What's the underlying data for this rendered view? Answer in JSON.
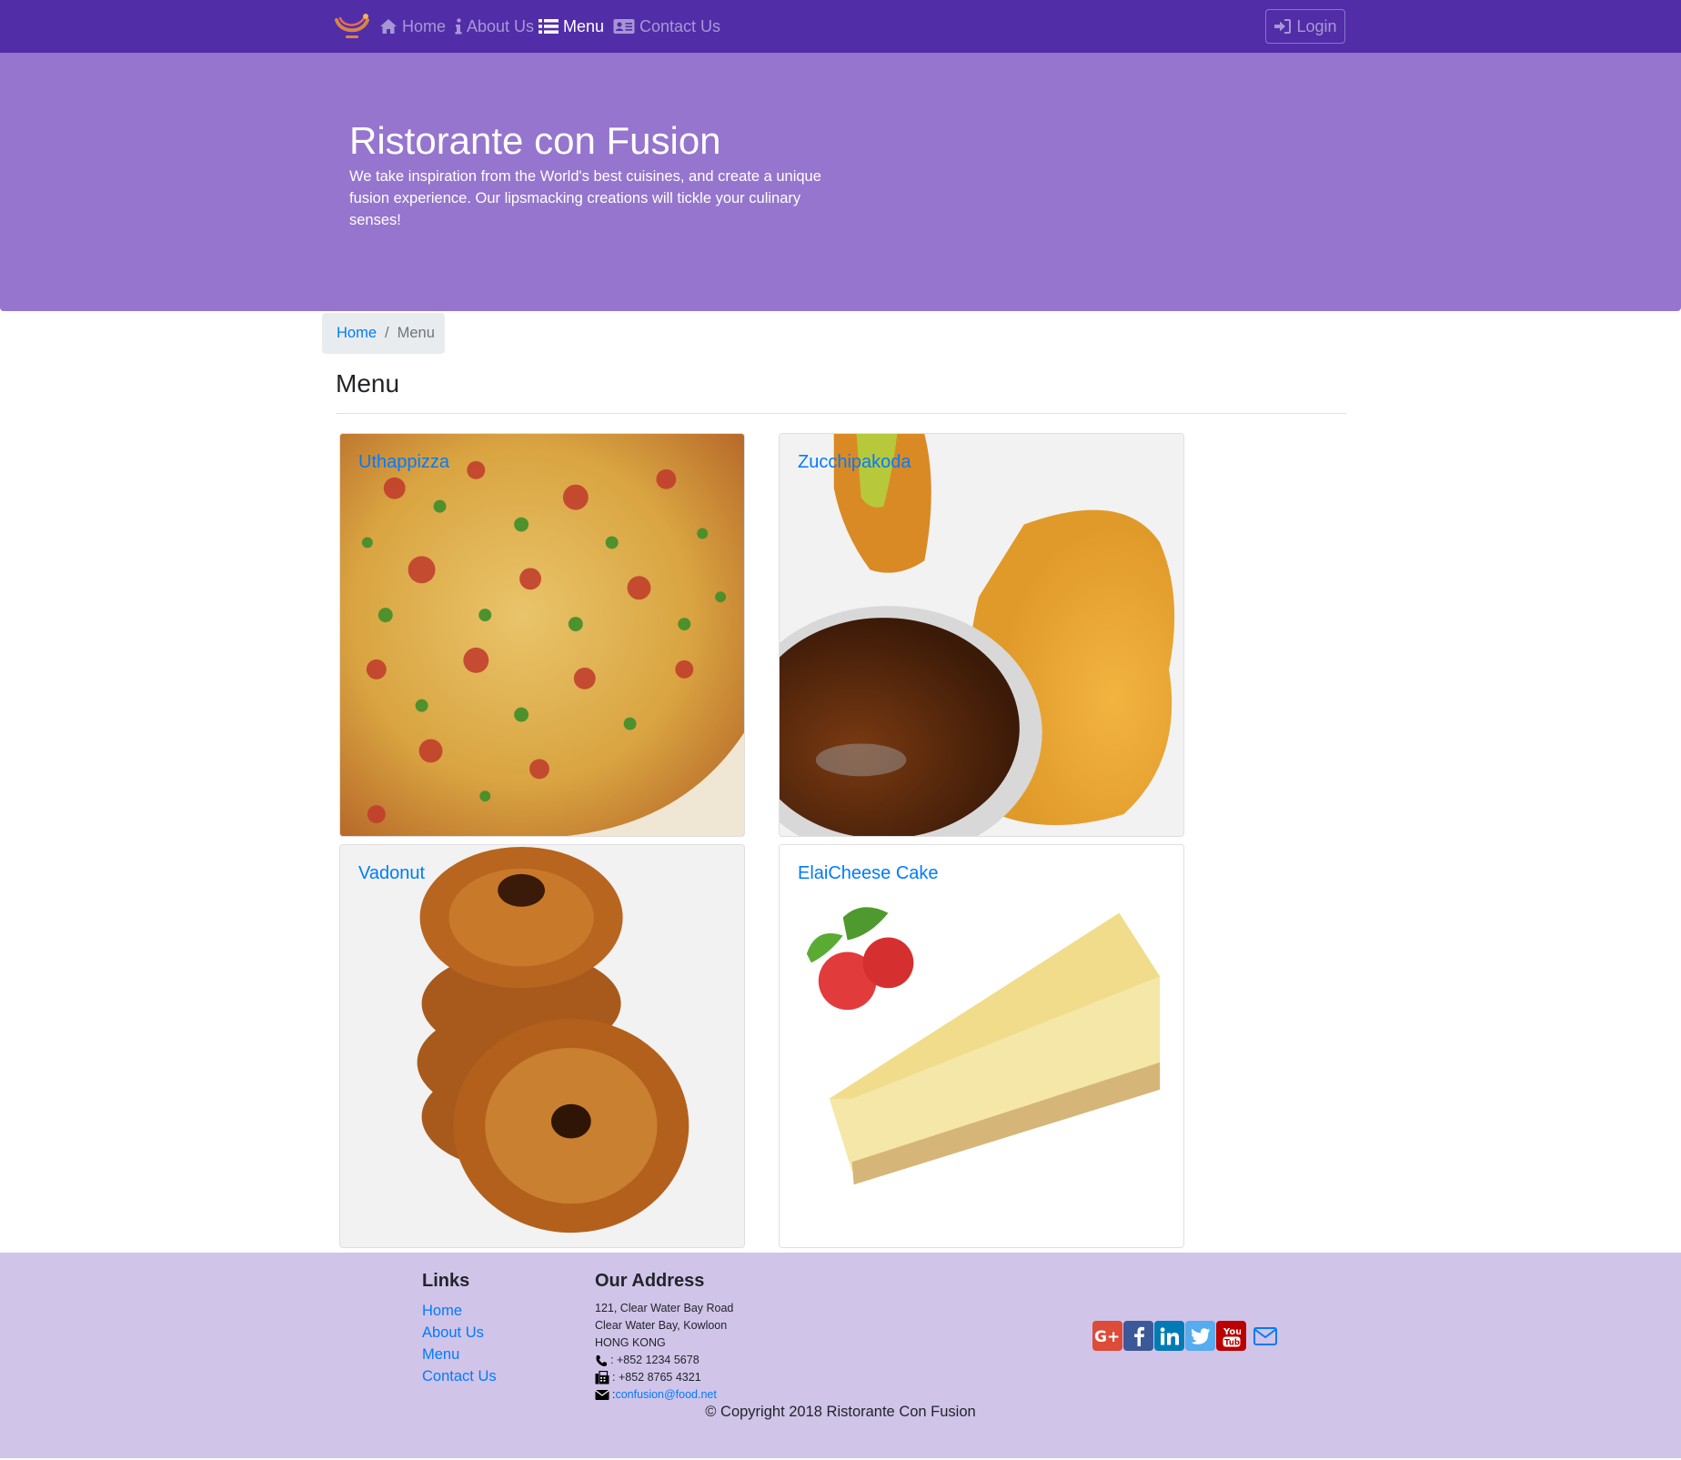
{
  "nav": {
    "items": [
      {
        "label": "Home",
        "icon": "home-icon"
      },
      {
        "label": "About Us",
        "icon": "info-icon"
      },
      {
        "label": "Menu",
        "icon": "list-icon",
        "active": true
      },
      {
        "label": "Contact Us",
        "icon": "address-card-icon"
      }
    ],
    "login_label": "Login"
  },
  "jumbotron": {
    "title": "Ristorante con Fusion",
    "text": "We take inspiration from the World's best cuisines, and create a unique fusion experience. Our lipsmacking creations will tickle your culinary senses!"
  },
  "breadcrumb": {
    "home": "Home",
    "current": "Menu"
  },
  "heading": "Menu",
  "dishes": [
    {
      "name": "Uthappizza"
    },
    {
      "name": "Zucchipakoda"
    },
    {
      "name": "Vadonut"
    },
    {
      "name": "ElaiCheese Cake"
    }
  ],
  "footer": {
    "links_heading": "Links",
    "links": [
      "Home",
      "About Us",
      "Menu",
      "Contact Us"
    ],
    "address_heading": "Our Address",
    "address_lines": [
      "121, Clear Water Bay Road",
      "Clear Water Bay, Kowloon",
      "HONG KONG"
    ],
    "phone": ": +852 1234 5678",
    "fax": ": +852 8765 4321",
    "email_prefix": ": ",
    "email": "confusion@food.net",
    "social": [
      "google-plus-icon",
      "facebook-icon",
      "linkedin-icon",
      "twitter-icon",
      "youtube-icon",
      "envelope-icon"
    ],
    "copyright": "© Copyright 2018 Ristorante Con Fusion"
  },
  "colors": {
    "primary": "#512DA8",
    "jumbotron": "#9575CD",
    "footer": "#D1C4E9",
    "link": "#007bff"
  }
}
